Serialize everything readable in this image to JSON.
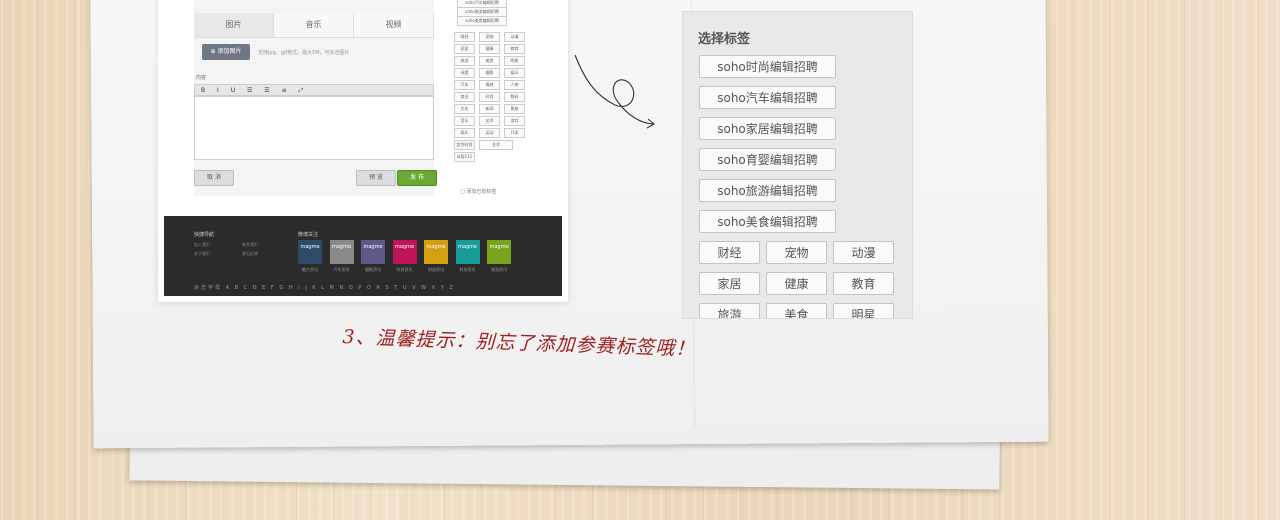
{
  "left_screenshot": {
    "tabs": [
      "图片",
      "音乐",
      "视频"
    ],
    "upload_button": "添加图片",
    "upload_hint": "支持jpg、gif格式，最大5M，可多选图片",
    "content_label": "内容",
    "toolbar_glyphs": "B I U ☰ ☰ ≡ ⤢",
    "cancel_button": "取 消",
    "preview_button": "预 览",
    "publish_button": "发 布",
    "mini_tags": [
      "soho汽车编辑招聘",
      "soho旅游编辑招聘",
      "soho美食编辑招聘",
      "财经",
      "宠物",
      "动漫",
      "家居",
      "健康",
      "教育",
      "旅游",
      "美食",
      "明星",
      "母婴",
      "摄影",
      "娱乐",
      "汽车",
      "情感",
      "人物",
      "商业",
      "时尚",
      "数码",
      "文化",
      "新闻",
      "星座",
      "音乐",
      "艺术",
      "游戏",
      "娱乐",
      "运动",
      "开发",
      "摄影",
      "女性时尚",
      "艺术",
      "母婴111"
    ],
    "tag_checkbox_label": "□ 添加已有标签",
    "footer": {
      "nav_title": "快捷导航",
      "nav_links": [
        "加入我们",
        "关于我们",
        "联系我们",
        "意见反馈"
      ],
      "follow_title": "微博关注",
      "magazines": [
        {
          "label": "magme",
          "caption": "魅力资讯",
          "color": "#2d4a6b"
        },
        {
          "label": "magme",
          "caption": "汽车资讯",
          "color": "#8a8a8a"
        },
        {
          "label": "magme",
          "caption": "摄影资讯",
          "color": "#5d5a8a"
        },
        {
          "label": "magme",
          "caption": "时尚资讯",
          "color": "#c0145a"
        },
        {
          "label": "magme",
          "caption": "财经资讯",
          "color": "#d2a010"
        },
        {
          "label": "magme",
          "caption": "科技资讯",
          "color": "#179b98"
        },
        {
          "label": "magme",
          "caption": "旅游资讯",
          "color": "#7aa31c"
        }
      ],
      "alpha_index": "杂志字母   A  B  C  D  E  F  G  H  I  J  K  L  M  N  O  P  Q  R  S  T  U  V  W  X  Y  Z"
    }
  },
  "panel": {
    "title": "选择标签",
    "long_tags": [
      "soho时尚编辑招聘",
      "soho汽车编辑招聘",
      "soho家居编辑招聘",
      "soho育婴编辑招聘",
      "soho旅游编辑招聘",
      "soho美食编辑招聘"
    ],
    "short_tags": [
      "财经",
      "宠物",
      "动漫",
      "家居",
      "健康",
      "教育",
      "旅游",
      "美食",
      "明星"
    ]
  },
  "tip_text": "3、温馨提示：别忘了添加参赛标签哦！",
  "colors": {
    "publish_green": "#6aa933",
    "tip_red": "#a02020",
    "upload_gray": "#6e7783"
  }
}
